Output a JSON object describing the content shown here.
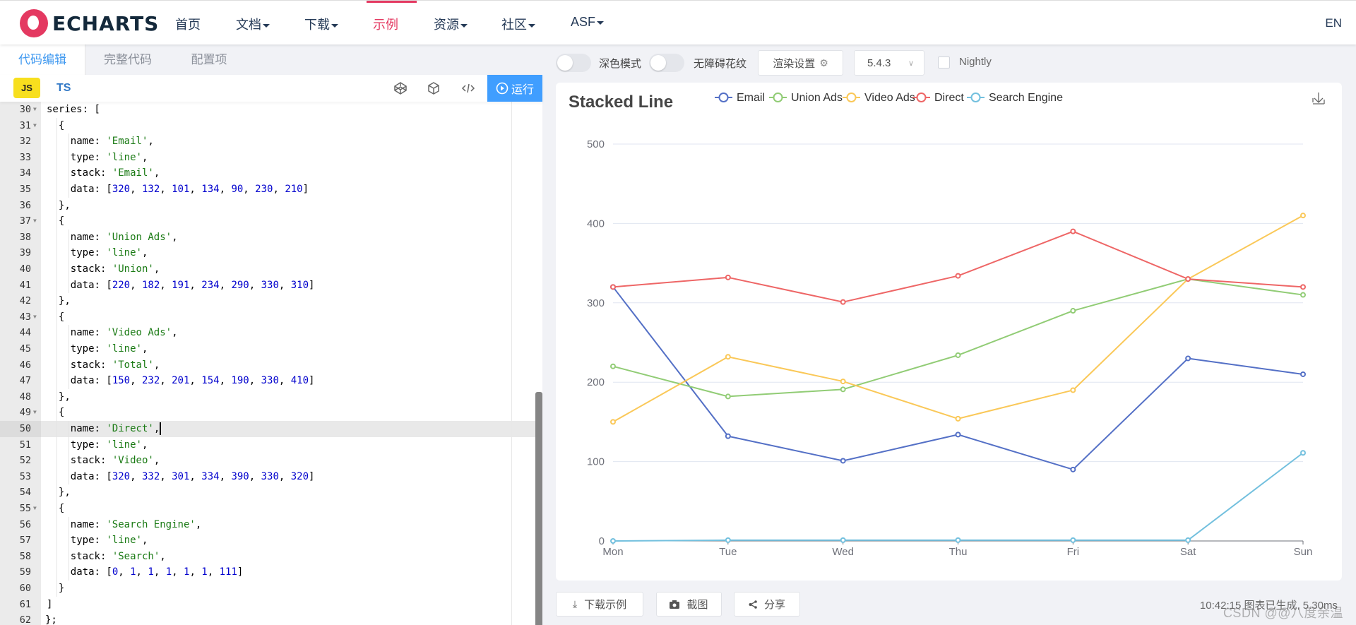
{
  "header": {
    "logo_text": "ECHARTS",
    "nav": [
      {
        "label": "首页",
        "dropdown": false,
        "active": false
      },
      {
        "label": "文档",
        "dropdown": true,
        "active": false
      },
      {
        "label": "下载",
        "dropdown": true,
        "active": false
      },
      {
        "label": "示例",
        "dropdown": false,
        "active": true
      },
      {
        "label": "资源",
        "dropdown": true,
        "active": false
      },
      {
        "label": "社区",
        "dropdown": true,
        "active": false
      },
      {
        "label": "ASF",
        "dropdown": true,
        "active": false
      }
    ],
    "lang": "EN",
    "accent": "#e43961"
  },
  "editor": {
    "tabs": [
      {
        "label": "代码编辑",
        "active": true
      },
      {
        "label": "完整代码",
        "active": false
      },
      {
        "label": "配置项",
        "active": false
      }
    ],
    "lang_js": "JS",
    "lang_ts": "TS",
    "toolbar_icons": [
      "codepen-icon",
      "codesandbox-icon",
      "code-format-icon"
    ],
    "run_label": "运行",
    "active_line": 50,
    "lines": [
      {
        "n": 30,
        "fold": true,
        "indent": 1,
        "tokens": [
          [
            "k",
            "series: ["
          ]
        ]
      },
      {
        "n": 31,
        "fold": true,
        "indent": 2,
        "tokens": [
          [
            "k",
            "{"
          ]
        ]
      },
      {
        "n": 32,
        "fold": false,
        "indent": 3,
        "tokens": [
          [
            "k",
            "name: "
          ],
          [
            "s",
            "'Email'"
          ],
          [
            "k",
            ","
          ]
        ]
      },
      {
        "n": 33,
        "fold": false,
        "indent": 3,
        "tokens": [
          [
            "k",
            "type: "
          ],
          [
            "s",
            "'line'"
          ],
          [
            "k",
            ","
          ]
        ]
      },
      {
        "n": 34,
        "fold": false,
        "indent": 3,
        "tokens": [
          [
            "k",
            "stack: "
          ],
          [
            "s",
            "'Email'"
          ],
          [
            "k",
            ","
          ]
        ]
      },
      {
        "n": 35,
        "fold": false,
        "indent": 3,
        "tokens": [
          [
            "k",
            "data: ["
          ],
          [
            "n",
            "320"
          ],
          [
            "k",
            ", "
          ],
          [
            "n",
            "132"
          ],
          [
            "k",
            ", "
          ],
          [
            "n",
            "101"
          ],
          [
            "k",
            ", "
          ],
          [
            "n",
            "134"
          ],
          [
            "k",
            ", "
          ],
          [
            "n",
            "90"
          ],
          [
            "k",
            ", "
          ],
          [
            "n",
            "230"
          ],
          [
            "k",
            ", "
          ],
          [
            "n",
            "210"
          ],
          [
            "k",
            "]"
          ]
        ]
      },
      {
        "n": 36,
        "fold": false,
        "indent": 2,
        "tokens": [
          [
            "k",
            "},"
          ]
        ]
      },
      {
        "n": 37,
        "fold": true,
        "indent": 2,
        "tokens": [
          [
            "k",
            "{"
          ]
        ]
      },
      {
        "n": 38,
        "fold": false,
        "indent": 3,
        "tokens": [
          [
            "k",
            "name: "
          ],
          [
            "s",
            "'Union Ads'"
          ],
          [
            "k",
            ","
          ]
        ]
      },
      {
        "n": 39,
        "fold": false,
        "indent": 3,
        "tokens": [
          [
            "k",
            "type: "
          ],
          [
            "s",
            "'line'"
          ],
          [
            "k",
            ","
          ]
        ]
      },
      {
        "n": 40,
        "fold": false,
        "indent": 3,
        "tokens": [
          [
            "k",
            "stack: "
          ],
          [
            "s",
            "'Union'"
          ],
          [
            "k",
            ","
          ]
        ]
      },
      {
        "n": 41,
        "fold": false,
        "indent": 3,
        "tokens": [
          [
            "k",
            "data: ["
          ],
          [
            "n",
            "220"
          ],
          [
            "k",
            ", "
          ],
          [
            "n",
            "182"
          ],
          [
            "k",
            ", "
          ],
          [
            "n",
            "191"
          ],
          [
            "k",
            ", "
          ],
          [
            "n",
            "234"
          ],
          [
            "k",
            ", "
          ],
          [
            "n",
            "290"
          ],
          [
            "k",
            ", "
          ],
          [
            "n",
            "330"
          ],
          [
            "k",
            ", "
          ],
          [
            "n",
            "310"
          ],
          [
            "k",
            "]"
          ]
        ]
      },
      {
        "n": 42,
        "fold": false,
        "indent": 2,
        "tokens": [
          [
            "k",
            "},"
          ]
        ]
      },
      {
        "n": 43,
        "fold": true,
        "indent": 2,
        "tokens": [
          [
            "k",
            "{"
          ]
        ]
      },
      {
        "n": 44,
        "fold": false,
        "indent": 3,
        "tokens": [
          [
            "k",
            "name: "
          ],
          [
            "s",
            "'Video Ads'"
          ],
          [
            "k",
            ","
          ]
        ]
      },
      {
        "n": 45,
        "fold": false,
        "indent": 3,
        "tokens": [
          [
            "k",
            "type: "
          ],
          [
            "s",
            "'line'"
          ],
          [
            "k",
            ","
          ]
        ]
      },
      {
        "n": 46,
        "fold": false,
        "indent": 3,
        "tokens": [
          [
            "k",
            "stack: "
          ],
          [
            "s",
            "'Total'"
          ],
          [
            "k",
            ","
          ]
        ]
      },
      {
        "n": 47,
        "fold": false,
        "indent": 3,
        "tokens": [
          [
            "k",
            "data: ["
          ],
          [
            "n",
            "150"
          ],
          [
            "k",
            ", "
          ],
          [
            "n",
            "232"
          ],
          [
            "k",
            ", "
          ],
          [
            "n",
            "201"
          ],
          [
            "k",
            ", "
          ],
          [
            "n",
            "154"
          ],
          [
            "k",
            ", "
          ],
          [
            "n",
            "190"
          ],
          [
            "k",
            ", "
          ],
          [
            "n",
            "330"
          ],
          [
            "k",
            ", "
          ],
          [
            "n",
            "410"
          ],
          [
            "k",
            "]"
          ]
        ]
      },
      {
        "n": 48,
        "fold": false,
        "indent": 2,
        "tokens": [
          [
            "k",
            "},"
          ]
        ]
      },
      {
        "n": 49,
        "fold": true,
        "indent": 2,
        "tokens": [
          [
            "k",
            "{"
          ]
        ]
      },
      {
        "n": 50,
        "fold": false,
        "indent": 3,
        "tokens": [
          [
            "k",
            "name: "
          ],
          [
            "s",
            "'Direct'"
          ],
          [
            "k",
            ","
          ]
        ]
      },
      {
        "n": 51,
        "fold": false,
        "indent": 3,
        "tokens": [
          [
            "k",
            "type: "
          ],
          [
            "s",
            "'line'"
          ],
          [
            "k",
            ","
          ]
        ]
      },
      {
        "n": 52,
        "fold": false,
        "indent": 3,
        "tokens": [
          [
            "k",
            "stack: "
          ],
          [
            "s",
            "'Video'"
          ],
          [
            "k",
            ","
          ]
        ]
      },
      {
        "n": 53,
        "fold": false,
        "indent": 3,
        "tokens": [
          [
            "k",
            "data: ["
          ],
          [
            "n",
            "320"
          ],
          [
            "k",
            ", "
          ],
          [
            "n",
            "332"
          ],
          [
            "k",
            ", "
          ],
          [
            "n",
            "301"
          ],
          [
            "k",
            ", "
          ],
          [
            "n",
            "334"
          ],
          [
            "k",
            ", "
          ],
          [
            "n",
            "390"
          ],
          [
            "k",
            ", "
          ],
          [
            "n",
            "330"
          ],
          [
            "k",
            ", "
          ],
          [
            "n",
            "320"
          ],
          [
            "k",
            "]"
          ]
        ]
      },
      {
        "n": 54,
        "fold": false,
        "indent": 2,
        "tokens": [
          [
            "k",
            "},"
          ]
        ]
      },
      {
        "n": 55,
        "fold": true,
        "indent": 2,
        "tokens": [
          [
            "k",
            "{"
          ]
        ]
      },
      {
        "n": 56,
        "fold": false,
        "indent": 3,
        "tokens": [
          [
            "k",
            "name: "
          ],
          [
            "s",
            "'Search Engine'"
          ],
          [
            "k",
            ","
          ]
        ]
      },
      {
        "n": 57,
        "fold": false,
        "indent": 3,
        "tokens": [
          [
            "k",
            "type: "
          ],
          [
            "s",
            "'line'"
          ],
          [
            "k",
            ","
          ]
        ]
      },
      {
        "n": 58,
        "fold": false,
        "indent": 3,
        "tokens": [
          [
            "k",
            "stack: "
          ],
          [
            "s",
            "'Search'"
          ],
          [
            "k",
            ","
          ]
        ]
      },
      {
        "n": 59,
        "fold": false,
        "indent": 3,
        "tokens": [
          [
            "k",
            "data: ["
          ],
          [
            "n",
            "0"
          ],
          [
            "k",
            ", "
          ],
          [
            "n",
            "1"
          ],
          [
            "k",
            ", "
          ],
          [
            "n",
            "1"
          ],
          [
            "k",
            ", "
          ],
          [
            "n",
            "1"
          ],
          [
            "k",
            ", "
          ],
          [
            "n",
            "1"
          ],
          [
            "k",
            ", "
          ],
          [
            "n",
            "1"
          ],
          [
            "k",
            ", "
          ],
          [
            "n",
            "111"
          ],
          [
            "k",
            "]"
          ]
        ]
      },
      {
        "n": 60,
        "fold": false,
        "indent": 2,
        "tokens": [
          [
            "k",
            "}"
          ]
        ]
      },
      {
        "n": 61,
        "fold": false,
        "indent": 1,
        "tokens": [
          [
            "k",
            "]"
          ]
        ]
      },
      {
        "n": 62,
        "fold": false,
        "indent": 0,
        "tokens": [
          [
            "k",
            "};"
          ]
        ]
      }
    ]
  },
  "preview_toolbar": {
    "dark_mode_label": "深色模式",
    "dark_mode_on": false,
    "aria_label": "无障碍花纹",
    "aria_on": false,
    "render_settings_label": "渲染设置",
    "version": "5.4.3",
    "nightly_label": "Nightly",
    "nightly_checked": false
  },
  "chart_data": {
    "type": "line",
    "title": "Stacked Line",
    "categories": [
      "Mon",
      "Tue",
      "Wed",
      "Thu",
      "Fri",
      "Sat",
      "Sun"
    ],
    "series": [
      {
        "name": "Email",
        "color": "#5470c6",
        "values": [
          320,
          132,
          101,
          134,
          90,
          230,
          210
        ]
      },
      {
        "name": "Union Ads",
        "color": "#91cc75",
        "values": [
          220,
          182,
          191,
          234,
          290,
          330,
          310
        ]
      },
      {
        "name": "Video Ads",
        "color": "#fac858",
        "values": [
          150,
          232,
          201,
          154,
          190,
          330,
          410
        ]
      },
      {
        "name": "Direct",
        "color": "#ee6666",
        "values": [
          320,
          332,
          301,
          334,
          390,
          330,
          320
        ]
      },
      {
        "name": "Search Engine",
        "color": "#73c0de",
        "values": [
          0,
          1,
          1,
          1,
          1,
          1,
          111
        ]
      }
    ],
    "xlabel": "",
    "ylabel": "",
    "ylim": [
      0,
      500
    ],
    "yticks": [
      0,
      100,
      200,
      300,
      400,
      500
    ],
    "grid": true,
    "legend": "top-center"
  },
  "bottom_bar": {
    "download_label": "下载示例",
    "screenshot_label": "截图",
    "share_label": "分享",
    "status": "10:42:15  图表已生成, 5.30ms",
    "watermark": "CSDN @@八度余温"
  }
}
